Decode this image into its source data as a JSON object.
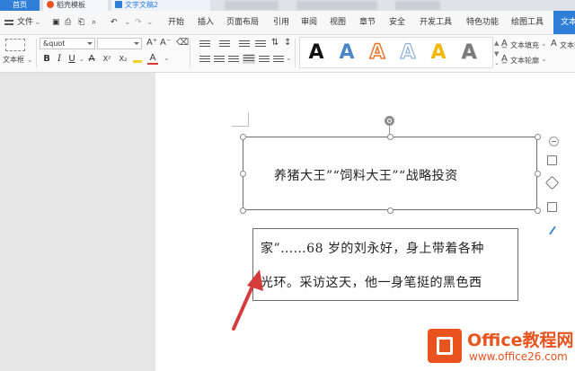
{
  "tabs": {
    "home": "首页",
    "store": "稻壳模板",
    "document": "文字文稿2"
  },
  "menu": {
    "file": "文件",
    "items": [
      "开始",
      "插入",
      "页面布局",
      "引用",
      "审阅",
      "视图",
      "章节",
      "安全",
      "开发工具",
      "特色功能",
      "绘图工具",
      "文本"
    ]
  },
  "ribbon": {
    "textbox_label": "文本框",
    "font_name": "&quot",
    "font_size": "",
    "text_fill": "文本填充",
    "text_outline": "文本轮廓",
    "text_effect": "文本效",
    "style_glyph": "A",
    "format_glyphs": [
      "B",
      "I",
      "U",
      "A",
      "X²",
      "X₂",
      "A"
    ]
  },
  "colors": {
    "accent": "#2f7fd8",
    "watermark": "#e8531e",
    "arrow": "#d63b3b",
    "styles": [
      "#111111",
      "#4a86c8",
      "#e8762c",
      "#a8c4e0",
      "#f2b705",
      "#7a7a7a"
    ]
  },
  "document": {
    "textbox_text": "养猪大王”“饲料大王”“战略投资",
    "para_lines": [
      "家”……68 岁的刘永好，身上带着各种",
      "光环。采访这天，他一身笔挺的黑色西"
    ]
  },
  "watermark": {
    "title": "Office教程网",
    "url": "www.office26.com"
  }
}
